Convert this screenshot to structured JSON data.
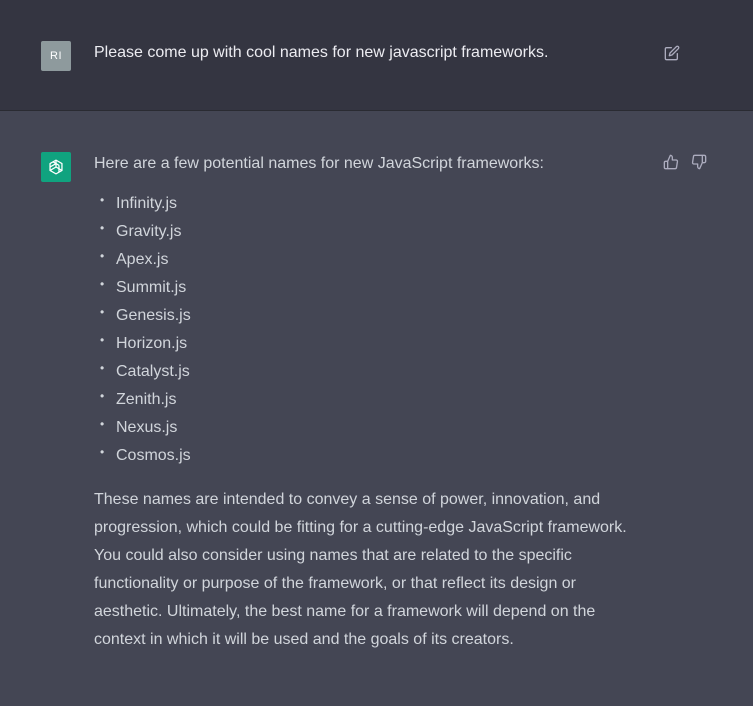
{
  "user": {
    "avatar_initials": "RI",
    "message": "Please come up with cool names for new javascript frameworks."
  },
  "assistant": {
    "intro": "Here are a few potential names for new JavaScript frameworks:",
    "names": [
      "Infinity.js",
      "Gravity.js",
      "Apex.js",
      "Summit.js",
      "Genesis.js",
      "Horizon.js",
      "Catalyst.js",
      "Zenith.js",
      "Nexus.js",
      "Cosmos.js"
    ],
    "outro_lines": [
      "These names are intended to convey a sense of power, innovation, and",
      "progression, which could be fitting for a cutting-edge JavaScript framework.",
      "You could also consider using names that are related to the specific",
      "functionality or purpose of the framework, or that reflect its design or",
      "aesthetic. Ultimately, the best name for a framework will depend on the",
      "context in which it will be used and the goals of its creators."
    ]
  },
  "icons": {
    "edit": "edit-icon",
    "thumbs_up": "thumbs-up-icon",
    "thumbs_down": "thumbs-down-icon",
    "bot_logo": "openai-logo-icon"
  },
  "colors": {
    "user_row_bg": "#343541",
    "assistant_row_bg": "#444654",
    "bot_avatar_bg": "#10a37f",
    "user_avatar_bg": "#8e9a9d",
    "text": "#d1d5db"
  }
}
